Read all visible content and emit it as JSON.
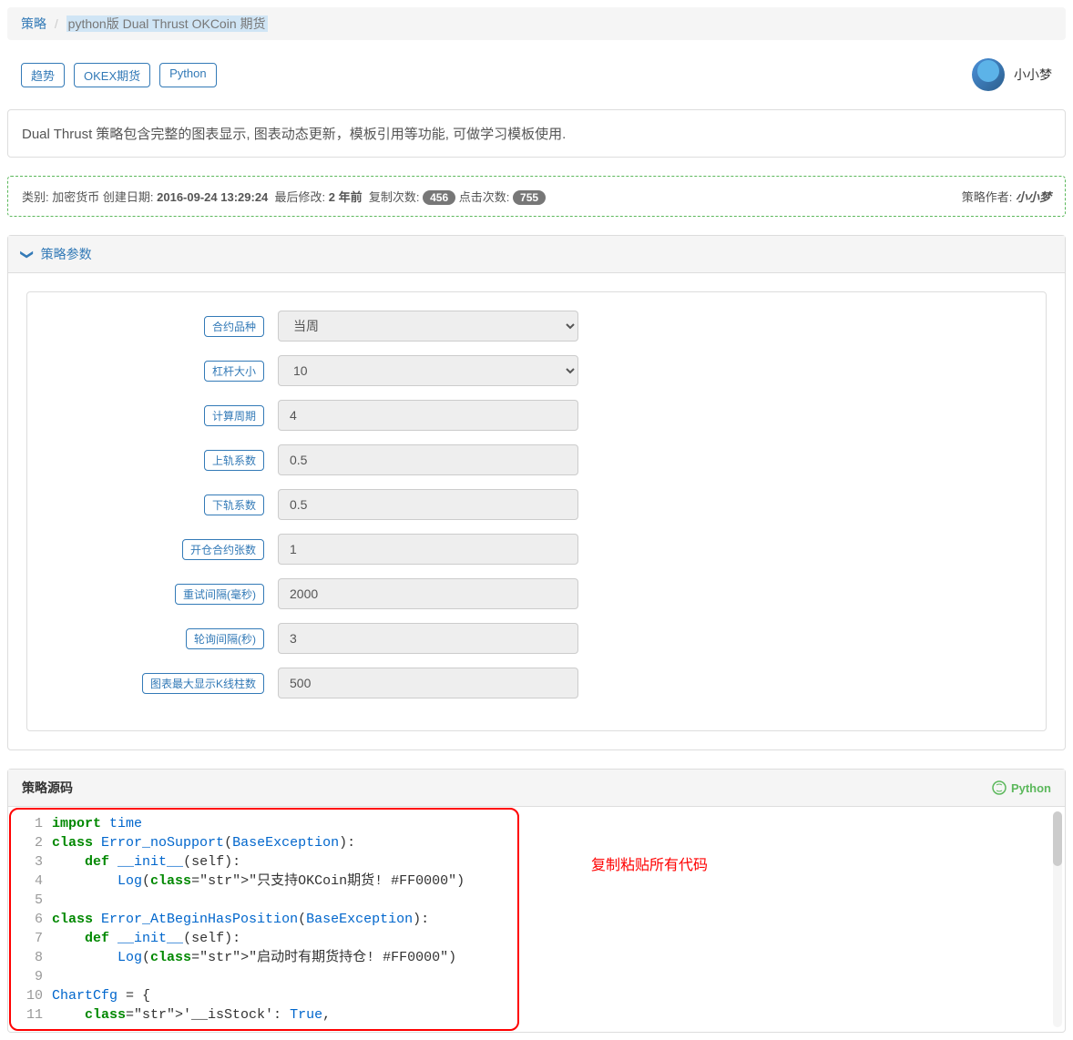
{
  "breadcrumb": {
    "root": "策略",
    "current": "python版 Dual Thrust OKCoin 期货"
  },
  "tags": [
    "趋势",
    "OKEX期货",
    "Python"
  ],
  "author": "小小梦",
  "description": "Dual Thrust 策略包含完整的图表显示, 图表动态更新，模板引用等功能, 可做学习模板使用.",
  "meta": {
    "category_label": "类别:",
    "category_value": "加密货币",
    "created_label": "创建日期:",
    "created_value": "2016-09-24 13:29:24",
    "modified_label": "最后修改:",
    "modified_value": "2 年前",
    "copy_label": "复制次数:",
    "copy_count": "456",
    "click_label": "点击次数:",
    "click_count": "755",
    "author_label": "策略作者:",
    "author_value": "小小梦"
  },
  "params_heading": "策略参数",
  "params": [
    {
      "label": "合约品种",
      "type": "select",
      "value": "当周"
    },
    {
      "label": "杠杆大小",
      "type": "select",
      "value": "10"
    },
    {
      "label": "计算周期",
      "type": "text",
      "value": "4"
    },
    {
      "label": "上轨系数",
      "type": "text",
      "value": "0.5"
    },
    {
      "label": "下轨系数",
      "type": "text",
      "value": "0.5"
    },
    {
      "label": "开仓合约张数",
      "type": "text",
      "value": "1"
    },
    {
      "label": "重试间隔(毫秒)",
      "type": "text",
      "value": "2000"
    },
    {
      "label": "轮询间隔(秒)",
      "type": "text",
      "value": "3"
    },
    {
      "label": "图表最大显示K线柱数",
      "type": "text",
      "value": "500"
    }
  ],
  "source_heading": "策略源码",
  "source_lang": "Python",
  "overlay_note": "复制粘贴所有代码",
  "code_raw": "import time\nclass Error_noSupport(BaseException):\n    def __init__(self):\n        Log(\"只支持OKCoin期货! #FF0000\")\n\nclass Error_AtBeginHasPosition(BaseException):\n    def __init__(self):\n        Log(\"启动时有期货持仓! #FF0000\")\n\nChartCfg = {\n    '__isStock': True,"
}
